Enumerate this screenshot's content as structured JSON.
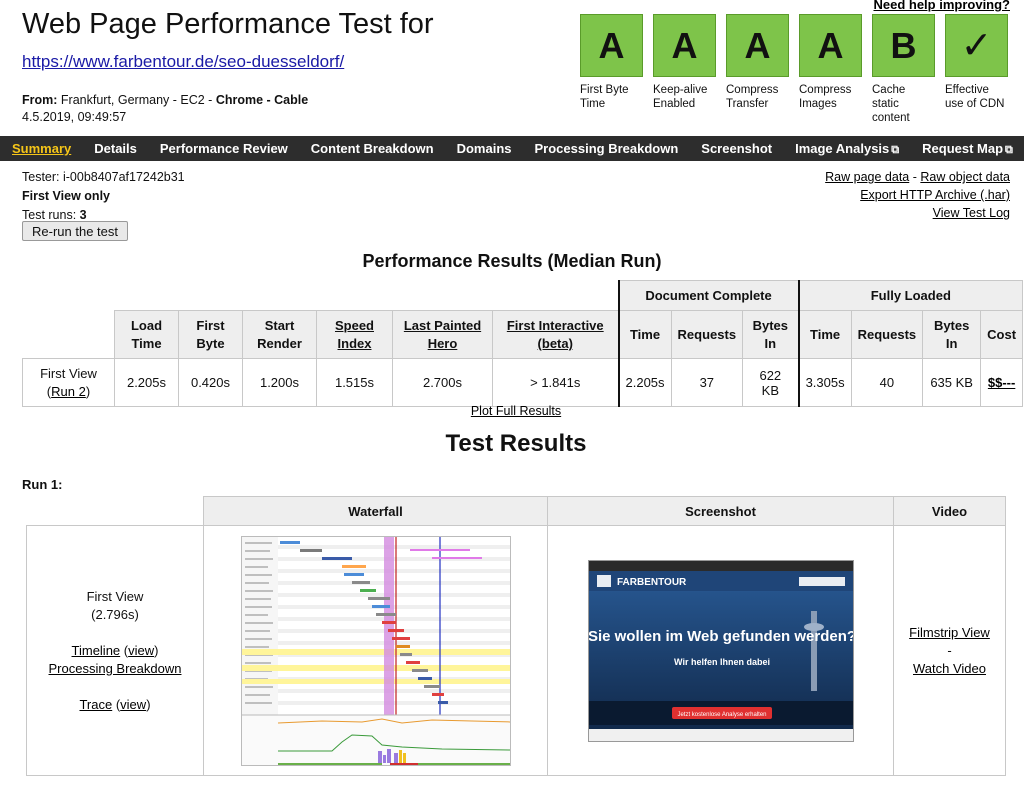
{
  "header": {
    "title": "Web Page Performance Test for",
    "url": "https://www.farbentour.de/seo-duesseldorf/",
    "from_label": "From:",
    "from_location": "Frankfurt, Germany - EC2 - ",
    "from_browser": "Chrome",
    "from_sep": " - ",
    "from_connection": "Cable",
    "timestamp": "4.5.2019, 09:49:57",
    "help_link": "Need help improving?"
  },
  "grades": [
    {
      "grade": "A",
      "label": "First Byte Time"
    },
    {
      "grade": "A",
      "label": "Keep-alive Enabled"
    },
    {
      "grade": "A",
      "label": "Compress Transfer"
    },
    {
      "grade": "A",
      "label": "Compress Images"
    },
    {
      "grade": "B",
      "label": "Cache static content"
    },
    {
      "grade": "✓",
      "label": "Effective use of CDN"
    }
  ],
  "nav": {
    "items": [
      "Summary",
      "Details",
      "Performance Review",
      "Content Breakdown",
      "Domains",
      "Processing Breakdown",
      "Screenshot",
      "Image Analysis",
      "Request Map"
    ],
    "external_icon": "⧉"
  },
  "tester": {
    "tester_line": "Tester: i-00b8407af17242b31",
    "first_view": "First View only",
    "runs_label": "Test runs: ",
    "runs_value": "3",
    "rerun_button": "Re-run the test"
  },
  "links": {
    "raw_page": "Raw page data",
    "dash": " - ",
    "raw_object": "Raw object data",
    "export_har": "Export HTTP Archive (.har)",
    "view_log": "View Test Log"
  },
  "performance": {
    "title": "Performance Results (Median Run)",
    "group_doc": "Document Complete",
    "group_full": "Fully Loaded",
    "headers": {
      "load_time": "Load Time",
      "first_byte": "First Byte",
      "start_render": "Start Render",
      "speed_index": "Speed Index",
      "last_painted": "Last Painted Hero",
      "first_interactive": "First Interactive (beta)",
      "time": "Time",
      "requests": "Requests",
      "bytes_in": "Bytes In",
      "cost": "Cost"
    },
    "row": {
      "label": "First View",
      "run_link": "Run 2",
      "load_time": "2.205s",
      "first_byte": "0.420s",
      "start_render": "1.200s",
      "speed_index": "1.515s",
      "last_painted": "2.700s",
      "first_interactive": "> 1.841s",
      "doc_time": "2.205s",
      "doc_requests": "37",
      "doc_bytes": "622 KB",
      "full_time": "3.305s",
      "full_requests": "40",
      "full_bytes": "635 KB",
      "cost": "$$---"
    },
    "plot_link": "Plot Full Results"
  },
  "test_results": {
    "title": "Test Results",
    "run_label": "Run 1:",
    "col_waterfall": "Waterfall",
    "col_screenshot": "Screenshot",
    "col_video": "Video",
    "first_view": "First View",
    "first_view_time": "(2.796s)",
    "timeline": "Timeline",
    "view": "view",
    "processing": "Processing Breakdown",
    "trace": "Trace",
    "filmstrip": "Filmstrip View",
    "dash": "-",
    "watch_video": "Watch Video"
  },
  "screenshot": {
    "brand": "FARBENTOUR",
    "headline": "Sie wollen im Web gefunden werden?",
    "subline": "Wir helfen Ihnen dabei",
    "cta": "Jetzt kostenlose Analyse erhalten"
  },
  "colors": {
    "grade_green": "#7ec44a",
    "nav_bg": "#2d2d2d",
    "nav_active": "#f5c518",
    "url_blue": "#1a1aa6"
  }
}
